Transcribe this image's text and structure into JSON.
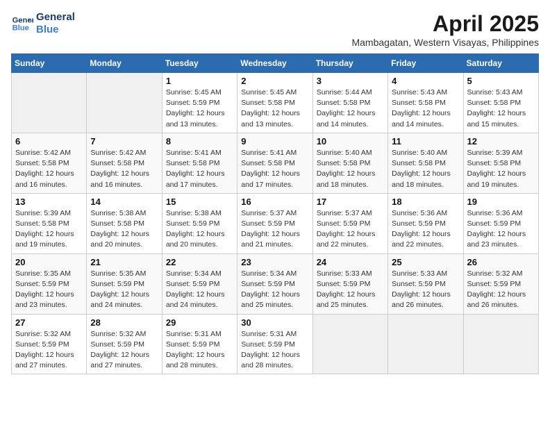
{
  "logo": {
    "line1": "General",
    "line2": "Blue"
  },
  "title": "April 2025",
  "location": "Mambagatan, Western Visayas, Philippines",
  "weekdays": [
    "Sunday",
    "Monday",
    "Tuesday",
    "Wednesday",
    "Thursday",
    "Friday",
    "Saturday"
  ],
  "weeks": [
    [
      {
        "day": "",
        "info": ""
      },
      {
        "day": "",
        "info": ""
      },
      {
        "day": "1",
        "info": "Sunrise: 5:45 AM\nSunset: 5:59 PM\nDaylight: 12 hours\nand 13 minutes."
      },
      {
        "day": "2",
        "info": "Sunrise: 5:45 AM\nSunset: 5:58 PM\nDaylight: 12 hours\nand 13 minutes."
      },
      {
        "day": "3",
        "info": "Sunrise: 5:44 AM\nSunset: 5:58 PM\nDaylight: 12 hours\nand 14 minutes."
      },
      {
        "day": "4",
        "info": "Sunrise: 5:43 AM\nSunset: 5:58 PM\nDaylight: 12 hours\nand 14 minutes."
      },
      {
        "day": "5",
        "info": "Sunrise: 5:43 AM\nSunset: 5:58 PM\nDaylight: 12 hours\nand 15 minutes."
      }
    ],
    [
      {
        "day": "6",
        "info": "Sunrise: 5:42 AM\nSunset: 5:58 PM\nDaylight: 12 hours\nand 16 minutes."
      },
      {
        "day": "7",
        "info": "Sunrise: 5:42 AM\nSunset: 5:58 PM\nDaylight: 12 hours\nand 16 minutes."
      },
      {
        "day": "8",
        "info": "Sunrise: 5:41 AM\nSunset: 5:58 PM\nDaylight: 12 hours\nand 17 minutes."
      },
      {
        "day": "9",
        "info": "Sunrise: 5:41 AM\nSunset: 5:58 PM\nDaylight: 12 hours\nand 17 minutes."
      },
      {
        "day": "10",
        "info": "Sunrise: 5:40 AM\nSunset: 5:58 PM\nDaylight: 12 hours\nand 18 minutes."
      },
      {
        "day": "11",
        "info": "Sunrise: 5:40 AM\nSunset: 5:58 PM\nDaylight: 12 hours\nand 18 minutes."
      },
      {
        "day": "12",
        "info": "Sunrise: 5:39 AM\nSunset: 5:58 PM\nDaylight: 12 hours\nand 19 minutes."
      }
    ],
    [
      {
        "day": "13",
        "info": "Sunrise: 5:39 AM\nSunset: 5:58 PM\nDaylight: 12 hours\nand 19 minutes."
      },
      {
        "day": "14",
        "info": "Sunrise: 5:38 AM\nSunset: 5:58 PM\nDaylight: 12 hours\nand 20 minutes."
      },
      {
        "day": "15",
        "info": "Sunrise: 5:38 AM\nSunset: 5:59 PM\nDaylight: 12 hours\nand 20 minutes."
      },
      {
        "day": "16",
        "info": "Sunrise: 5:37 AM\nSunset: 5:59 PM\nDaylight: 12 hours\nand 21 minutes."
      },
      {
        "day": "17",
        "info": "Sunrise: 5:37 AM\nSunset: 5:59 PM\nDaylight: 12 hours\nand 22 minutes."
      },
      {
        "day": "18",
        "info": "Sunrise: 5:36 AM\nSunset: 5:59 PM\nDaylight: 12 hours\nand 22 minutes."
      },
      {
        "day": "19",
        "info": "Sunrise: 5:36 AM\nSunset: 5:59 PM\nDaylight: 12 hours\nand 23 minutes."
      }
    ],
    [
      {
        "day": "20",
        "info": "Sunrise: 5:35 AM\nSunset: 5:59 PM\nDaylight: 12 hours\nand 23 minutes."
      },
      {
        "day": "21",
        "info": "Sunrise: 5:35 AM\nSunset: 5:59 PM\nDaylight: 12 hours\nand 24 minutes."
      },
      {
        "day": "22",
        "info": "Sunrise: 5:34 AM\nSunset: 5:59 PM\nDaylight: 12 hours\nand 24 minutes."
      },
      {
        "day": "23",
        "info": "Sunrise: 5:34 AM\nSunset: 5:59 PM\nDaylight: 12 hours\nand 25 minutes."
      },
      {
        "day": "24",
        "info": "Sunrise: 5:33 AM\nSunset: 5:59 PM\nDaylight: 12 hours\nand 25 minutes."
      },
      {
        "day": "25",
        "info": "Sunrise: 5:33 AM\nSunset: 5:59 PM\nDaylight: 12 hours\nand 26 minutes."
      },
      {
        "day": "26",
        "info": "Sunrise: 5:32 AM\nSunset: 5:59 PM\nDaylight: 12 hours\nand 26 minutes."
      }
    ],
    [
      {
        "day": "27",
        "info": "Sunrise: 5:32 AM\nSunset: 5:59 PM\nDaylight: 12 hours\nand 27 minutes."
      },
      {
        "day": "28",
        "info": "Sunrise: 5:32 AM\nSunset: 5:59 PM\nDaylight: 12 hours\nand 27 minutes."
      },
      {
        "day": "29",
        "info": "Sunrise: 5:31 AM\nSunset: 5:59 PM\nDaylight: 12 hours\nand 28 minutes."
      },
      {
        "day": "30",
        "info": "Sunrise: 5:31 AM\nSunset: 5:59 PM\nDaylight: 12 hours\nand 28 minutes."
      },
      {
        "day": "",
        "info": ""
      },
      {
        "day": "",
        "info": ""
      },
      {
        "day": "",
        "info": ""
      }
    ]
  ]
}
